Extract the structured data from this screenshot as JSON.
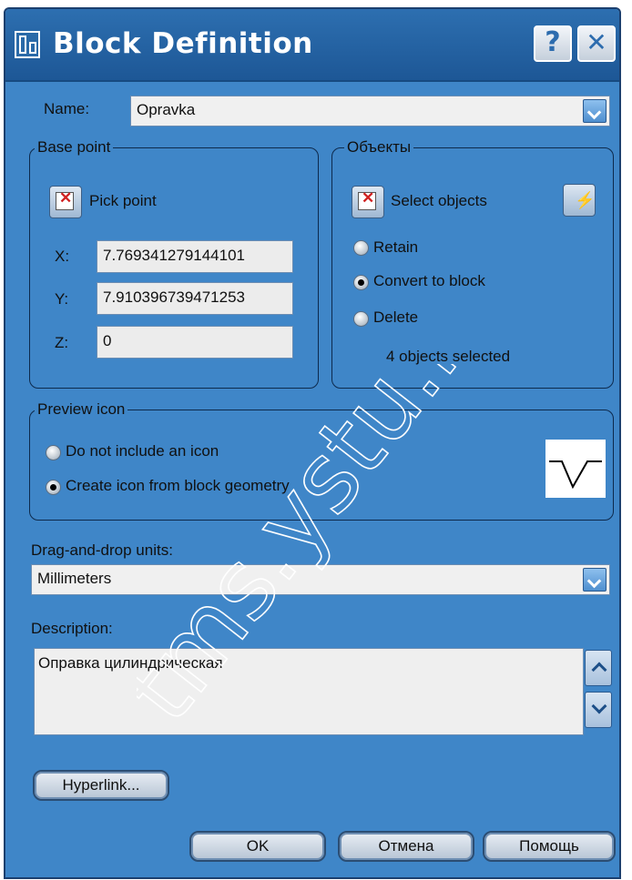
{
  "window": {
    "title": "Block Definition",
    "help_label": "?",
    "close_label": "✕"
  },
  "name": {
    "label": "Name:",
    "value": "Opravka"
  },
  "base_point": {
    "title": "Base point",
    "pick_label": "Pick point",
    "x_label": "X:",
    "x_value": "7.769341279144101",
    "y_label": "Y:",
    "y_value": "7.910396739471253",
    "z_label": "Z:",
    "z_value": "0"
  },
  "objects": {
    "title": "Объекты",
    "select_label": "Select objects",
    "retain_label": "Retain",
    "convert_label": "Convert to block",
    "delete_label": "Delete",
    "selected_count_text": "4 objects selected",
    "selected_option": "convert"
  },
  "preview_icon": {
    "title": "Preview icon",
    "no_icon_label": "Do not include an icon",
    "create_icon_label": "Create icon from block geometry",
    "selected_option": "create"
  },
  "units": {
    "label": "Drag-and-drop units:",
    "value": "Millimeters"
  },
  "description": {
    "label": "Description:",
    "value": "Оправка цилиндрическая"
  },
  "buttons": {
    "hyperlink": "Hyperlink...",
    "ok": "OK",
    "cancel": "Отмена",
    "help": "Помощь"
  },
  "watermark_text": "tms.ystu.ru",
  "colors": {
    "window_bg": "#3f86c8",
    "titlebar": "#1d5796",
    "field_bg": "#ececec"
  }
}
